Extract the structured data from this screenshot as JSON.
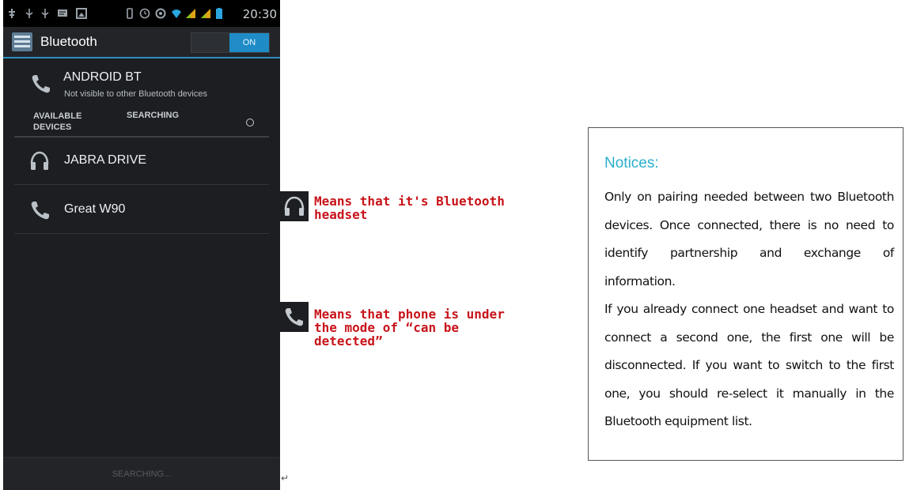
{
  "status_bar": {
    "time": "20:30",
    "icons": [
      "usb-debug-icon",
      "usb-icon",
      "usb-icon",
      "message-icon",
      "photo-icon",
      "vibrate-icon",
      "alarm-icon",
      "sync-icon",
      "wifi-icon",
      "signal-icon",
      "signal-icon",
      "battery-icon"
    ]
  },
  "action_bar": {
    "title": "Bluetooth",
    "icon": "bluetooth-settings-icon",
    "toggle_label": "ON"
  },
  "this_device": {
    "name": "ANDROID BT",
    "visibility": "Not visible to other Bluetooth devices",
    "icon": "phone-icon"
  },
  "section": {
    "available_label": "AVAILABLE\nDEVICES",
    "searching_label": "SEARCHING"
  },
  "devices": [
    {
      "name": "JABRA DRIVE",
      "icon": "headset-icon"
    },
    {
      "name": "Great W90",
      "icon": "phone-icon"
    }
  ],
  "bottom_bar": {
    "label": "SEARCHING..."
  },
  "legend": {
    "headset_text": "Means that it's Bluetooth\nheadset",
    "phone_text": "Means that phone is under\nthe mode of “can be\ndetected”"
  },
  "notice": {
    "title": "Notices:",
    "paragraph1": "Only on pairing needed between two Bluetooth devices. Once connected, there is no need to identify partnership and exchange of information.",
    "paragraph2": "If you already connect one headset and want to connect a second one, the first one will be disconnected. If you want to switch to the first one, you should re-select it manually in the Bluetooth equipment list."
  },
  "colors": {
    "accent": "#1f8cc7",
    "annotation": "#c8141a",
    "notice_title": "#2ab0cc"
  }
}
